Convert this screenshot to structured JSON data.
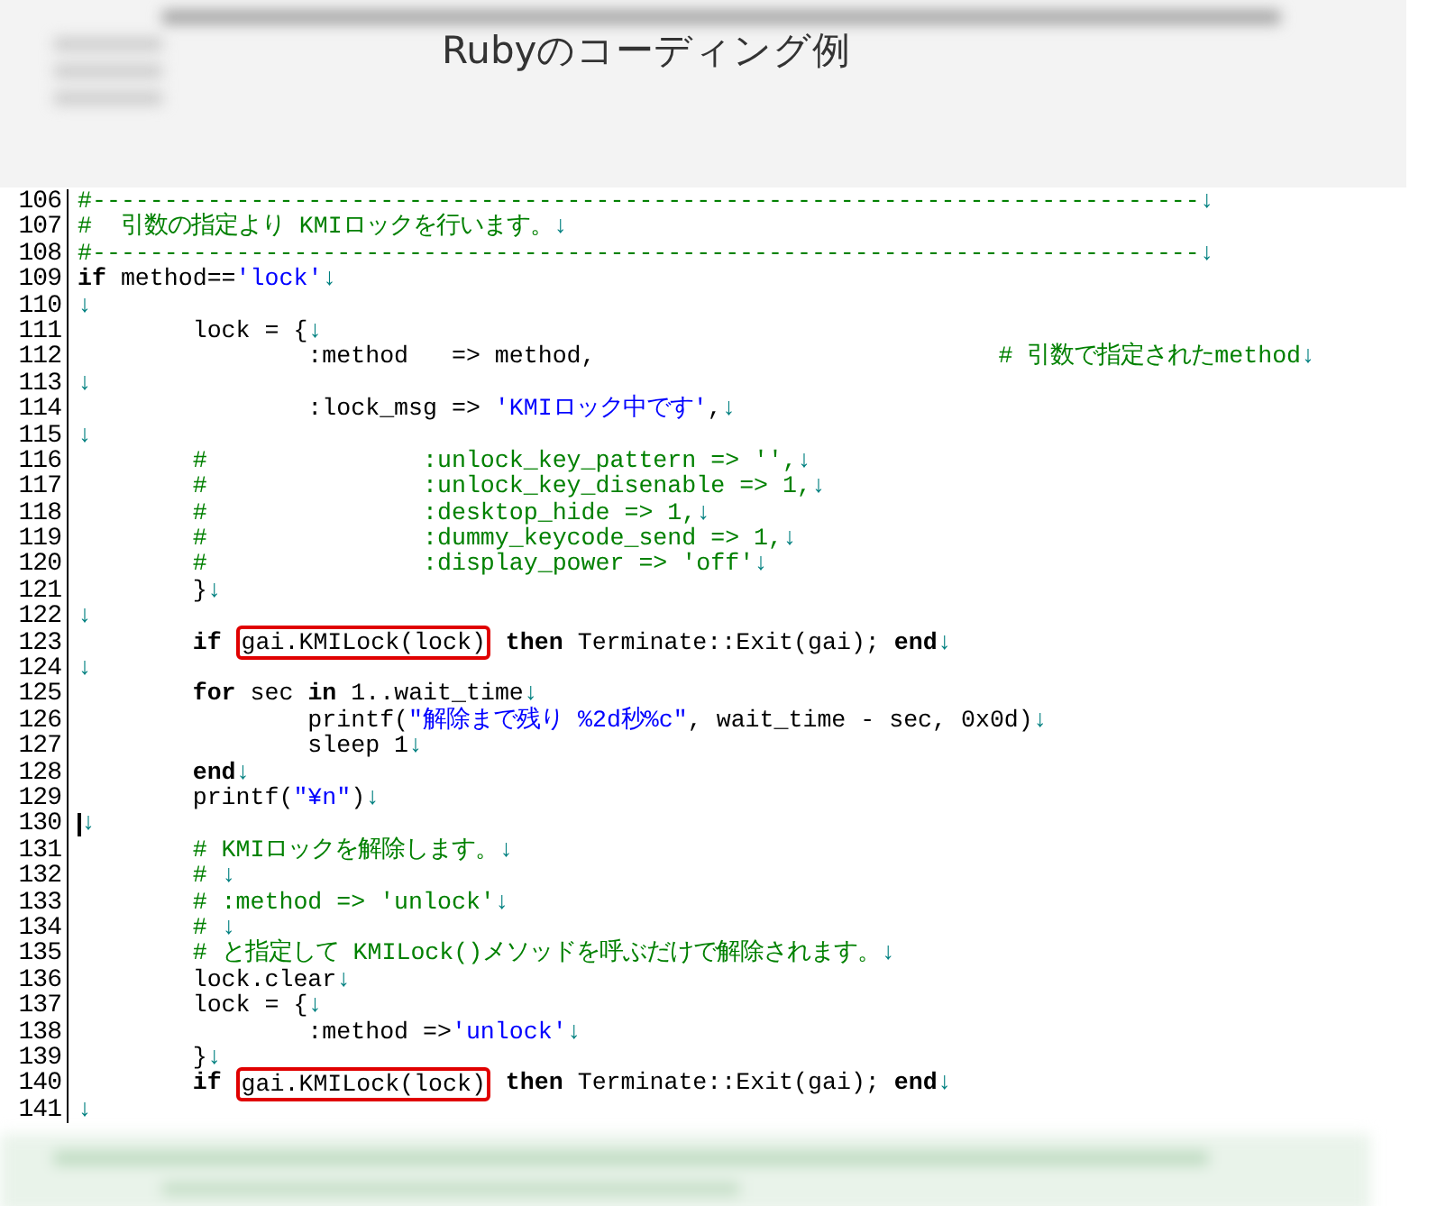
{
  "title": "Rubyのコーディング例",
  "lines": [
    {
      "number": "106",
      "tokens": [
        {
          "kind": "comment",
          "text": "#-----------------------------------------------------------------------------"
        },
        {
          "kind": "eol",
          "text": "↓"
        }
      ]
    },
    {
      "number": "107",
      "tokens": [
        {
          "kind": "comment",
          "text": "#  引数の指定より KMIロックを行います。"
        },
        {
          "kind": "eol",
          "text": "↓"
        }
      ]
    },
    {
      "number": "108",
      "tokens": [
        {
          "kind": "comment",
          "text": "#-----------------------------------------------------------------------------"
        },
        {
          "kind": "eol",
          "text": "↓"
        }
      ]
    },
    {
      "number": "109",
      "tokens": [
        {
          "kind": "keyword",
          "text": "if"
        },
        {
          "kind": "plain",
          "text": " method=="
        },
        {
          "kind": "string",
          "text": "'lock'"
        },
        {
          "kind": "eol",
          "text": "↓"
        }
      ]
    },
    {
      "number": "110",
      "tokens": [
        {
          "kind": "eol",
          "text": "↓"
        }
      ]
    },
    {
      "number": "111",
      "tokens": [
        {
          "kind": "plain",
          "text": "\tlock = {"
        },
        {
          "kind": "eol",
          "text": "↓"
        }
      ]
    },
    {
      "number": "112",
      "tokens": [
        {
          "kind": "plain",
          "text": "\t\t:method   => method,"
        },
        {
          "kind": "comment",
          "text": "\t\t\t\t# 引数で指定されたmethod"
        },
        {
          "kind": "eol",
          "text": "↓"
        }
      ]
    },
    {
      "number": "113",
      "tokens": [
        {
          "kind": "eol",
          "text": "↓"
        }
      ]
    },
    {
      "number": "114",
      "tokens": [
        {
          "kind": "plain",
          "text": "\t\t:lock_msg => "
        },
        {
          "kind": "string",
          "text": "'KMIロック中です'"
        },
        {
          "kind": "plain",
          "text": ","
        },
        {
          "kind": "eol",
          "text": "↓"
        }
      ]
    },
    {
      "number": "115",
      "tokens": [
        {
          "kind": "eol",
          "text": "↓"
        }
      ]
    },
    {
      "number": "116",
      "tokens": [
        {
          "kind": "comment",
          "text": "\t#\t\t:unlock_key_pattern => '',"
        },
        {
          "kind": "eol",
          "text": "↓"
        }
      ]
    },
    {
      "number": "117",
      "tokens": [
        {
          "kind": "comment",
          "text": "\t#\t\t:unlock_key_disenable => 1,"
        },
        {
          "kind": "eol",
          "text": "↓"
        }
      ]
    },
    {
      "number": "118",
      "tokens": [
        {
          "kind": "comment",
          "text": "\t#\t\t:desktop_hide => 1,"
        },
        {
          "kind": "eol",
          "text": "↓"
        }
      ]
    },
    {
      "number": "119",
      "tokens": [
        {
          "kind": "comment",
          "text": "\t#\t\t:dummy_keycode_send => 1,"
        },
        {
          "kind": "eol",
          "text": "↓"
        }
      ]
    },
    {
      "number": "120",
      "tokens": [
        {
          "kind": "comment",
          "text": "\t#\t\t:display_power => 'off'"
        },
        {
          "kind": "eol",
          "text": "↓"
        }
      ]
    },
    {
      "number": "121",
      "tokens": [
        {
          "kind": "plain",
          "text": "\t}"
        },
        {
          "kind": "eol",
          "text": "↓"
        }
      ]
    },
    {
      "number": "122",
      "tokens": [
        {
          "kind": "eol",
          "text": "↓"
        }
      ]
    },
    {
      "number": "123",
      "tokens": [
        {
          "kind": "keyword",
          "text": "\tif "
        },
        {
          "kind": "boxed",
          "text": "gai.KMILock(lock)"
        },
        {
          "kind": "keyword",
          "text": " then"
        },
        {
          "kind": "plain",
          "text": " Terminate::Exit(gai); "
        },
        {
          "kind": "keyword",
          "text": "end"
        },
        {
          "kind": "eol",
          "text": "↓"
        }
      ]
    },
    {
      "number": "124",
      "tokens": [
        {
          "kind": "eol",
          "text": "↓"
        }
      ]
    },
    {
      "number": "125",
      "tokens": [
        {
          "kind": "keyword",
          "text": "\tfor"
        },
        {
          "kind": "plain",
          "text": " sec "
        },
        {
          "kind": "keyword",
          "text": "in"
        },
        {
          "kind": "plain",
          "text": " 1..wait_time"
        },
        {
          "kind": "eol",
          "text": "↓"
        }
      ]
    },
    {
      "number": "126",
      "tokens": [
        {
          "kind": "plain",
          "text": "\t\tprintf("
        },
        {
          "kind": "string",
          "text": "\"解除まで残り %2d秒%c\""
        },
        {
          "kind": "plain",
          "text": ", wait_time - sec, 0x0d)"
        },
        {
          "kind": "eol",
          "text": "↓"
        }
      ]
    },
    {
      "number": "127",
      "tokens": [
        {
          "kind": "plain",
          "text": "\t\tsleep 1"
        },
        {
          "kind": "eol",
          "text": "↓"
        }
      ]
    },
    {
      "number": "128",
      "tokens": [
        {
          "kind": "keyword",
          "text": "\tend"
        },
        {
          "kind": "eol",
          "text": "↓"
        }
      ]
    },
    {
      "number": "129",
      "tokens": [
        {
          "kind": "plain",
          "text": "\tprintf("
        },
        {
          "kind": "string",
          "text": "\"¥n\""
        },
        {
          "kind": "plain",
          "text": ")"
        },
        {
          "kind": "eol",
          "text": "↓"
        }
      ]
    },
    {
      "number": "130",
      "cursor": true,
      "tokens": [
        {
          "kind": "eol",
          "text": "↓"
        }
      ]
    },
    {
      "number": "131",
      "tokens": [
        {
          "kind": "comment",
          "text": "\t# KMIロックを解除します。"
        },
        {
          "kind": "eol",
          "text": "↓"
        }
      ]
    },
    {
      "number": "132",
      "tokens": [
        {
          "kind": "comment",
          "text": "\t# "
        },
        {
          "kind": "eol",
          "text": "↓"
        }
      ]
    },
    {
      "number": "133",
      "tokens": [
        {
          "kind": "comment",
          "text": "\t# :method => 'unlock'"
        },
        {
          "kind": "eol",
          "text": "↓"
        }
      ]
    },
    {
      "number": "134",
      "tokens": [
        {
          "kind": "comment",
          "text": "\t# "
        },
        {
          "kind": "eol",
          "text": "↓"
        }
      ]
    },
    {
      "number": "135",
      "tokens": [
        {
          "kind": "comment",
          "text": "\t# と指定して KMILock()メソッドを呼ぶだけで解除されます。"
        },
        {
          "kind": "eol",
          "text": "↓"
        }
      ]
    },
    {
      "number": "136",
      "tokens": [
        {
          "kind": "plain",
          "text": "\tlock.clear"
        },
        {
          "kind": "eol",
          "text": "↓"
        }
      ]
    },
    {
      "number": "137",
      "tokens": [
        {
          "kind": "plain",
          "text": "\tlock = {"
        },
        {
          "kind": "eol",
          "text": "↓"
        }
      ]
    },
    {
      "number": "138",
      "tokens": [
        {
          "kind": "plain",
          "text": "\t\t:method =>"
        },
        {
          "kind": "string",
          "text": "'unlock'"
        },
        {
          "kind": "eol",
          "text": "↓"
        }
      ]
    },
    {
      "number": "139",
      "tokens": [
        {
          "kind": "plain",
          "text": "\t}"
        },
        {
          "kind": "eol",
          "text": "↓"
        }
      ]
    },
    {
      "number": "140",
      "tokens": [
        {
          "kind": "keyword",
          "text": "\tif "
        },
        {
          "kind": "boxed",
          "text": "gai.KMILock(lock)"
        },
        {
          "kind": "keyword",
          "text": " then"
        },
        {
          "kind": "plain",
          "text": " Terminate::Exit(gai); "
        },
        {
          "kind": "keyword",
          "text": "end"
        },
        {
          "kind": "eol",
          "text": "↓"
        }
      ]
    },
    {
      "number": "141",
      "tokens": [
        {
          "kind": "eol",
          "text": "↓"
        }
      ]
    }
  ]
}
